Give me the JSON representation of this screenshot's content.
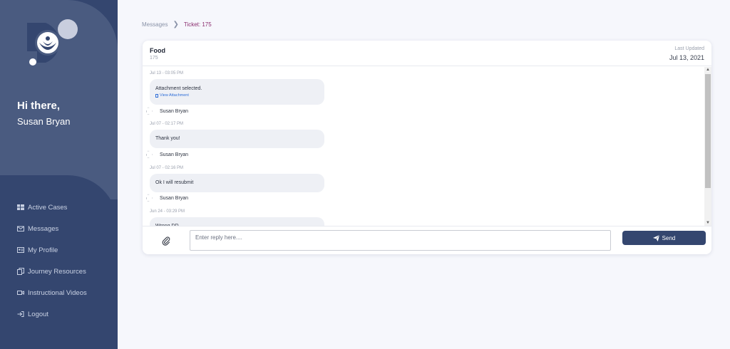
{
  "sidebar": {
    "greeting": "Hi there,",
    "user_name": "Susan Bryan",
    "items": [
      {
        "label": "Active Cases",
        "icon": "grid-icon"
      },
      {
        "label": "Messages",
        "icon": "envelope-icon"
      },
      {
        "label": "My Profile",
        "icon": "id-card-icon"
      },
      {
        "label": "Journey Resources",
        "icon": "copy-icon"
      },
      {
        "label": "Instructional Videos",
        "icon": "video-icon"
      },
      {
        "label": "Logout",
        "icon": "logout-icon"
      }
    ]
  },
  "breadcrumb": {
    "parent": "Messages",
    "current": "Ticket: 175"
  },
  "ticket": {
    "title": "Food",
    "id": "175",
    "updated_label": "Last Updated",
    "updated_date": "Jul 13, 2021"
  },
  "messages": [
    {
      "time": "Jul 13 - 03:05 PM",
      "text": "Attachment selected.",
      "attachment_label": "View Attachment",
      "sender": "Susan Bryan"
    },
    {
      "time": "Jul 07 - 02:17 PM",
      "text": "Thank you!",
      "sender": "Susan Bryan"
    },
    {
      "time": "Jul 07 - 02:16 PM",
      "text": "Ok I will resubmit",
      "sender": "Susan Bryan"
    },
    {
      "time": "Jun 24 - 03:29 PM",
      "text": "Wrong DD"
    }
  ],
  "reply": {
    "placeholder": "Enter reply here....",
    "send_label": "Send"
  },
  "colors": {
    "sidebar": "#34466f",
    "sidebar_top": "#4a5b80",
    "accent_breadcrumb": "#8a2d6e",
    "link": "#2f6ed8"
  }
}
